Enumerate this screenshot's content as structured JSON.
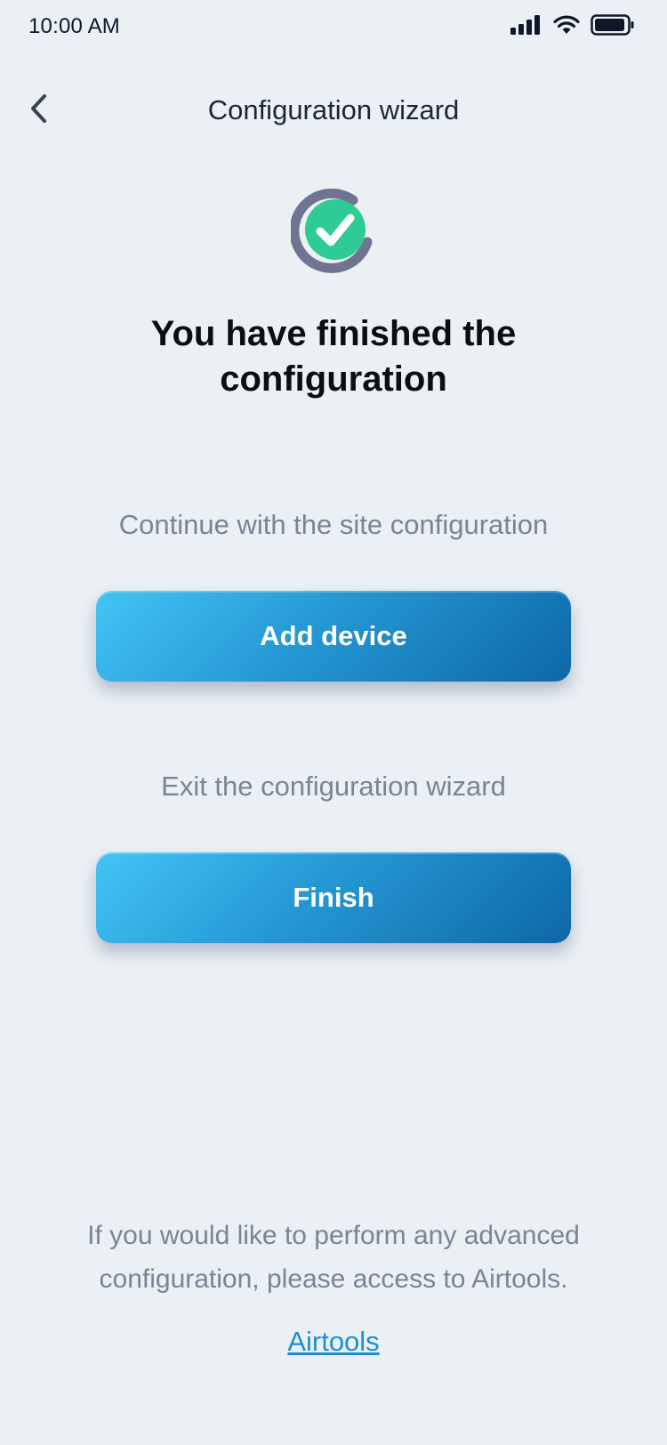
{
  "status_bar": {
    "time": "10:00 AM",
    "icons": [
      "cellular-signal-icon",
      "wifi-icon",
      "battery-icon"
    ]
  },
  "header": {
    "back_icon": "chevron-left-icon",
    "title": "Configuration wizard"
  },
  "success": {
    "icon": "check-circle-icon",
    "title": "You have finished the configuration"
  },
  "continue_section": {
    "prompt": "Continue with the site configuration",
    "button_label": "Add device"
  },
  "exit_section": {
    "prompt": "Exit the configuration wizard",
    "button_label": "Finish"
  },
  "advanced": {
    "text": "If you would like to perform any advanced configuration, please access to Airtools.",
    "link_label": "Airtools"
  },
  "colors": {
    "background": "#ebf0f4",
    "accent_gradient_start": "#43c4f4",
    "accent_gradient_end": "#0e67a6",
    "success_green": "#2ecc94",
    "ring_gray": "#6f7490",
    "link": "#1f8fd0",
    "muted_text": "#7a8494"
  }
}
